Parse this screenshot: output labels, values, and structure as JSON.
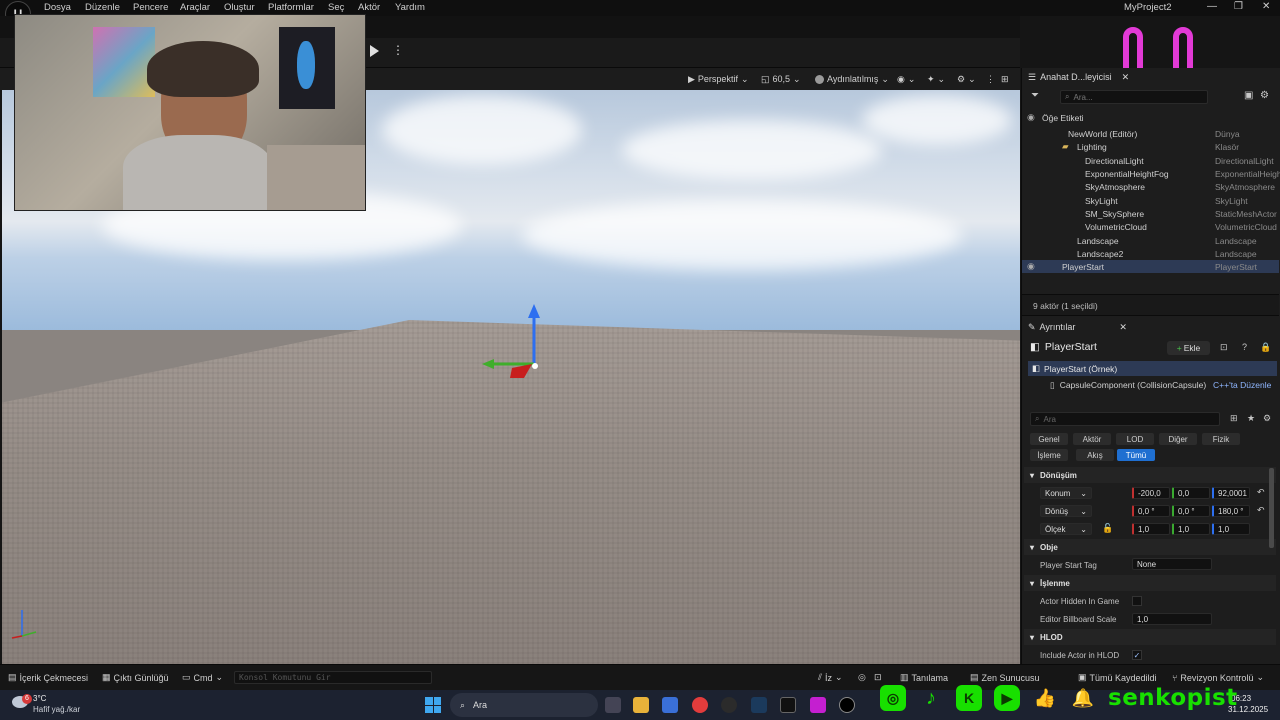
{
  "menu": [
    "Dosya",
    "Düzenle",
    "Pencere",
    "Araçlar",
    "Oluştur",
    "Platformlar",
    "Seç",
    "Aktör",
    "Yardım"
  ],
  "window_title": "MyProject2",
  "window_controls": {
    "minimize": "—",
    "restore": "❐",
    "close": "✕"
  },
  "viewport_toolbar": {
    "perspective": "Perspektif",
    "fov": "60,5",
    "lighting": "Aydınlatılmış"
  },
  "outliner": {
    "tab": "Anahat D...leyicisi",
    "search_placeholder": "Ara...",
    "header": "Öğe Etiketi",
    "rows": [
      {
        "name": "NewWorld (Editör)",
        "type": "Dünya"
      },
      {
        "name": "Lighting",
        "type": "Klasör"
      },
      {
        "name": "DirectionalLight",
        "type": "DirectionalLight"
      },
      {
        "name": "ExponentialHeightFog",
        "type": "ExponentialHeigh"
      },
      {
        "name": "SkyAtmosphere",
        "type": "SkyAtmosphere"
      },
      {
        "name": "SkyLight",
        "type": "SkyLight"
      },
      {
        "name": "SM_SkySphere",
        "type": "StaticMeshActor"
      },
      {
        "name": "VolumetricCloud",
        "type": "VolumetricCloud"
      },
      {
        "name": "Landscape",
        "type": "Landscape"
      },
      {
        "name": "Landscape2",
        "type": "Landscape"
      },
      {
        "name": "PlayerStart",
        "type": "PlayerStart"
      }
    ],
    "status": "9 aktör (1 seçildi)"
  },
  "details": {
    "tab": "Ayrıntılar",
    "actor_name": "PlayerStart",
    "add_label": "Ekle",
    "instance": "PlayerStart (Örnek)",
    "component": "CapsuleComponent (CollisionCapsule)",
    "cpp_edit": "C++'ta Düzenle",
    "search_placeholder": "Ara",
    "categories": [
      "Genel",
      "Aktör",
      "LOD",
      "Diğer",
      "Fizik",
      "İşleme",
      "Akış",
      "Tümü"
    ],
    "section_transform": "Dönüşüm",
    "location_label": "Konum",
    "location": [
      "-200,0",
      "0,0",
      "92,0001"
    ],
    "rotation_label": "Dönüş",
    "rotation": [
      "0,0 °",
      "0,0 °",
      "180,0 °"
    ],
    "scale_label": "Ölçek",
    "scale": [
      "1,0",
      "1,0",
      "1,0"
    ],
    "section_object": "Obje",
    "player_start_tag_label": "Player Start Tag",
    "player_start_tag": "None",
    "section_render": "İşlenme",
    "actor_hidden_label": "Actor Hidden In Game",
    "billboard_label": "Editor Billboard Scale",
    "billboard": "1,0",
    "section_hlod": "HLOD",
    "include_hlod_label": "Include Actor in HLOD"
  },
  "bottom": {
    "content": "İçerik Çekmecesi",
    "output": "Çıktı Günlüğü",
    "cmd": "Cmd",
    "console_placeholder": "Konsol Komutunu Gir",
    "trace": "İz",
    "derived": "Tanılama",
    "zen": "Zen Sunucusu",
    "saved": "Tümü Kaydedildi",
    "revision": "Revizyon Kontrolü"
  },
  "taskbar": {
    "weather_temp": "3°C",
    "weather_desc": "Hafif yağ./kar",
    "weather_badge": "6",
    "search": "Ara",
    "time": "06:23",
    "date": "31.12.2025"
  },
  "social": {
    "name": "senkopist"
  },
  "colors": {
    "accent": "#1f6fd1",
    "social_green": "#18e000",
    "smiley": "#e23ad6"
  }
}
